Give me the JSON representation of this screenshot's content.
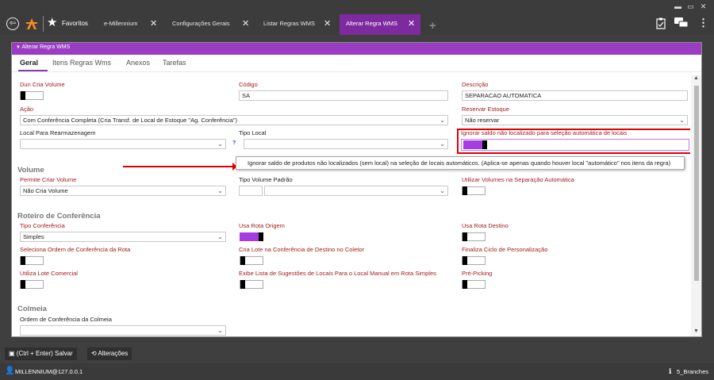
{
  "topbar": {
    "favorites_label": "Favoritos",
    "tabs": [
      {
        "label": "e-Millennium"
      },
      {
        "label": "Configurações Gerais"
      },
      {
        "label": "Listar Regras WMS"
      },
      {
        "label": "Alterar Regra WMS"
      }
    ]
  },
  "window": {
    "title": "Alterar Regra WMS",
    "subtabs": [
      "Geral",
      "Itens Regras Wms",
      "Anexos",
      "Tarefas"
    ]
  },
  "form": {
    "dun_cria_volume": {
      "label": "Dun Cria Volume"
    },
    "codigo": {
      "label": "Código",
      "value": "SA"
    },
    "descricao": {
      "label": "Descrição",
      "value": "SEPARACAO AUTOMATICA"
    },
    "acao": {
      "label": "Ação",
      "value": "Com Conferência Completa (Cria Transf. de Local de Estoque \"Ag. Conferência\")"
    },
    "reservar_estoque": {
      "label": "Reservar Estoque",
      "value": "Não reservar"
    },
    "local_rearmazenagem": {
      "label": "Local Para Rearmazenagem",
      "value": ""
    },
    "tipo_local": {
      "label": "Tipo Local",
      "value": ""
    },
    "ignorar_saldo": {
      "label": "Ignorar saldo não localizado para seleção automática de locais"
    },
    "tooltip": "Ignorar saldo de produtos não localizados (sem local) na seleção de locais automáticos. (Aplica-se apenas quando houver local \"automático\" nos itens da regra)",
    "volume_section": "Volume",
    "permite_criar_volume": {
      "label": "Permite Criar Volume",
      "value": "Não Cria Volume"
    },
    "tipo_volume_padrao": {
      "label": "Tipo Volume Padrão",
      "value": ""
    },
    "utilizar_volumes": {
      "label": "Utilizar Volumes na Separação Automática"
    },
    "roteiro_section": "Roteiro de Conferência",
    "tipo_conferencia": {
      "label": "Tipo Conferência",
      "value": "Simples"
    },
    "usa_rota_origem": {
      "label": "Usa Rota Origem"
    },
    "usa_rota_destino": {
      "label": "Usa Rota Destino"
    },
    "seleciona_ordem": {
      "label": "Seleciona Ordem de Conferência da Rota"
    },
    "cria_lote": {
      "label": "Cria Lote na Conferência de Destino no Coletor"
    },
    "finaliza_ciclo": {
      "label": "Finaliza Ciclo de Personalização"
    },
    "utiliza_lote": {
      "label": "Utiliza Lote Comercial"
    },
    "exibe_lista": {
      "label": "Exibe Lista de Sugestões de Locais Para o Local Manual em Rota Simples"
    },
    "pre_picking": {
      "label": "Pré-Picking"
    },
    "colmeia_section": "Colmeia",
    "ordem_colmeia": {
      "label": "Ordem de Conferência da Colmeia",
      "value": ""
    },
    "help_mark": "?"
  },
  "bottom": {
    "save_label": "(Ctrl + Enter) Salvar",
    "changes_label": "Alterações"
  },
  "status": {
    "user": "MILLENNIUM@127.0.0.1",
    "branch": "5_Branches"
  },
  "colors": {
    "accent": "#9b3cc4",
    "label_red": "#a31c1c",
    "toggle_on": "#a63de0"
  }
}
